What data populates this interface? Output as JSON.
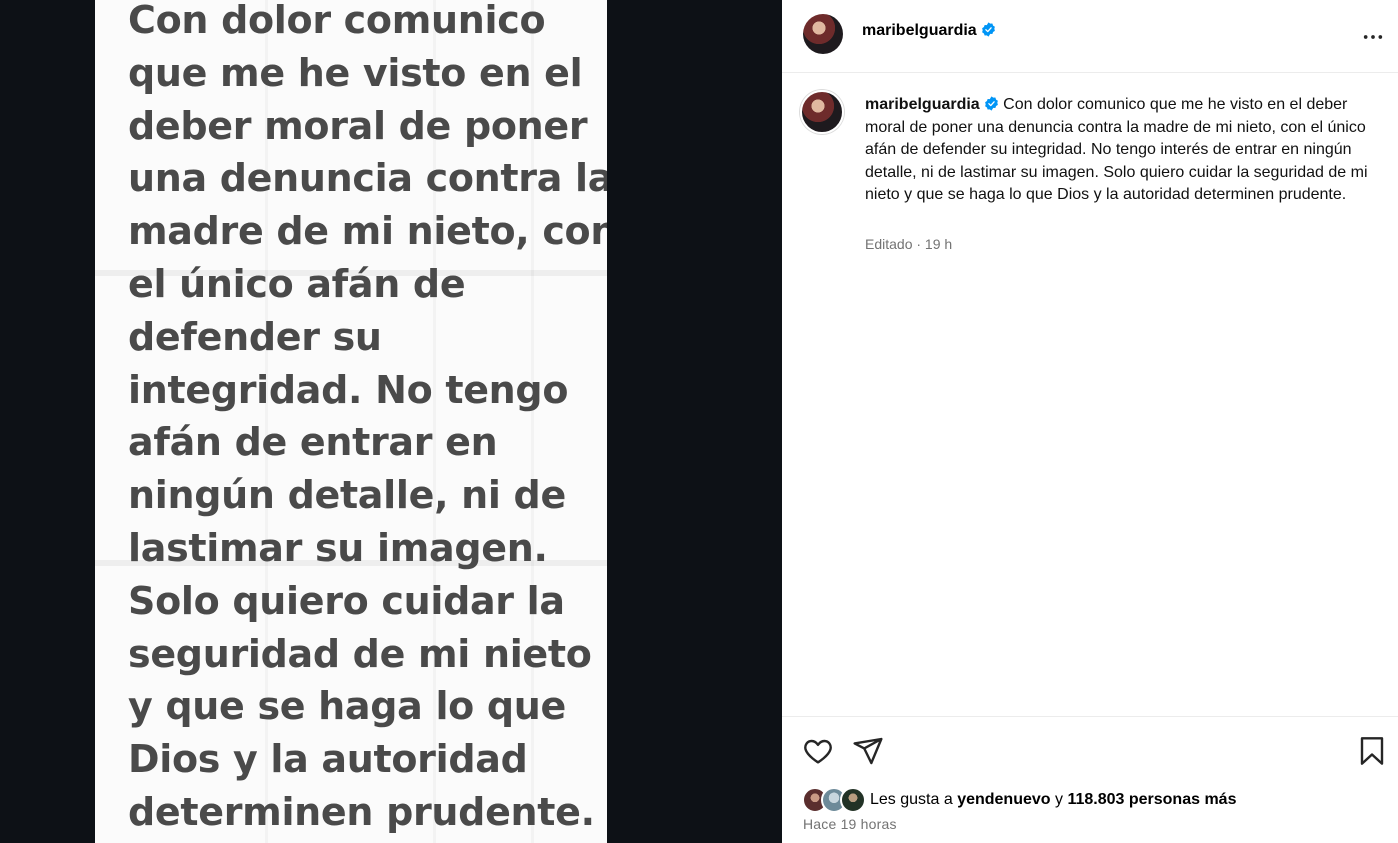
{
  "media": {
    "note_lines": [
      "Con dolor comunico",
      "que me he visto en el",
      "deber moral de poner",
      "una denuncia contra la",
      "madre de mi nieto, con",
      "el único afán de",
      "defender su",
      "integridad.  No tengo",
      "afán de entrar en",
      "ningún detalle, ni de",
      "lastimar su imagen.",
      "Solo quiero cuidar la",
      "seguridad de mi nieto",
      "y que se haga lo que",
      "Dios y la autoridad",
      "determinen prudente."
    ]
  },
  "header": {
    "username": "maribelguardia",
    "more_icon": "more-horizontal-icon",
    "verified_icon": "verified-badge-icon"
  },
  "caption": {
    "username": "maribelguardia",
    "text": "Con dolor comunico que me he visto en el deber moral de poner una denuncia contra la madre de mi nieto, con el único afán de defender su integridad. No tengo interés de entrar en ningún detalle, ni de lastimar su imagen. Solo quiero cuidar la seguridad de mi nieto y que se haga lo que Dios y la autoridad determinen prudente.",
    "meta": "Editado · 19 h"
  },
  "actions": {
    "like_icon": "heart-icon",
    "share_icon": "send-icon",
    "save_icon": "bookmark-icon"
  },
  "likes": {
    "prefix": "Les gusta a",
    "user": "yendenuevo",
    "connector": "y",
    "others": "118.803 personas más"
  },
  "time": "Hace 19 horas",
  "colors": {
    "media_background": "#0d1116",
    "note_text": "#4a4a4a",
    "verified_blue": "#0095f6",
    "meta_gray": "#737373"
  }
}
